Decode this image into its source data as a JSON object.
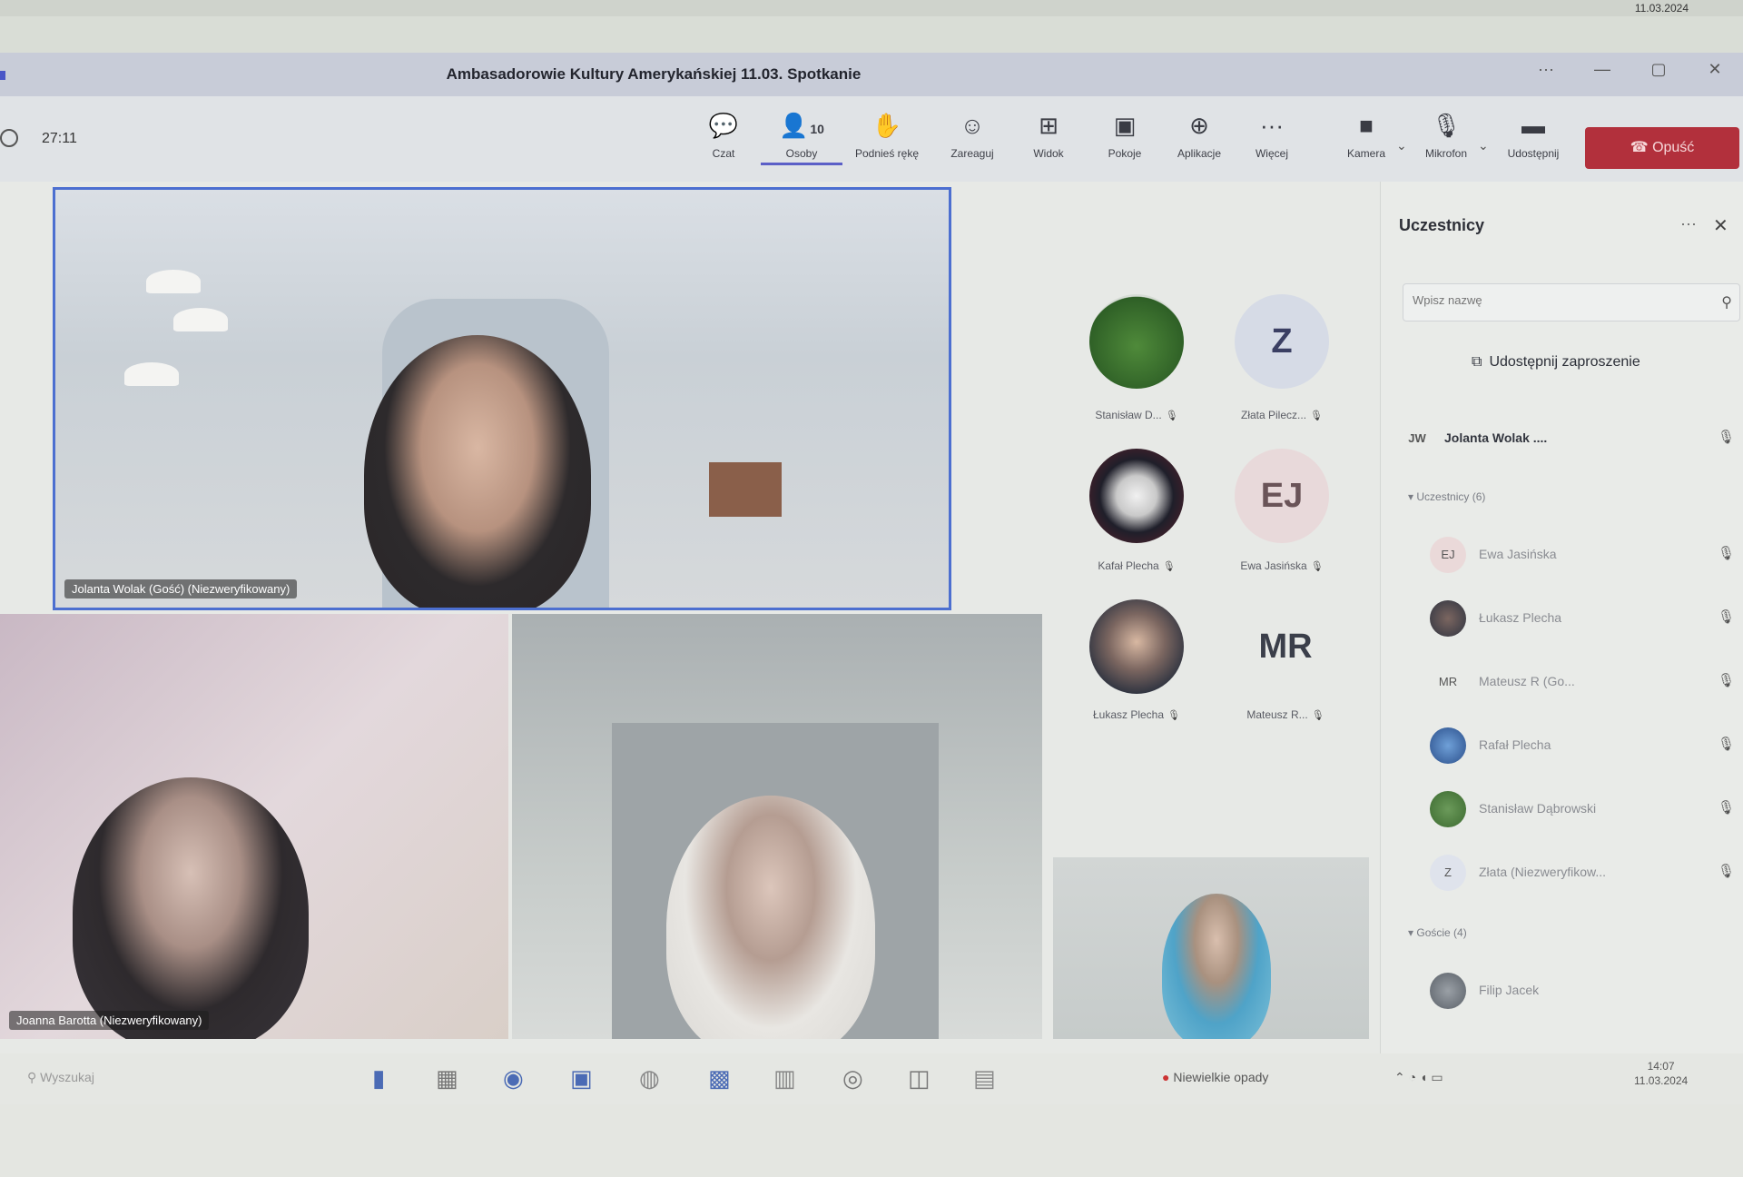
{
  "top_strip": {
    "date": "11.03.2024"
  },
  "window": {
    "title": "Ambasadorowie Kultury Amerykańskiej 11.03. Spotkanie",
    "controls": [
      "···",
      "—",
      "▢",
      "✕"
    ]
  },
  "toolbar": {
    "timer": "27:11",
    "buttons": [
      {
        "id": "chat",
        "label": "Czat",
        "icon": "chat-icon"
      },
      {
        "id": "people",
        "label": "Osoby",
        "icon": "people-icon",
        "count": "10",
        "active": true
      },
      {
        "id": "raise",
        "label": "Podnieś rękę",
        "icon": "hand-icon"
      },
      {
        "id": "react",
        "label": "Zareaguj",
        "icon": "smiley-icon"
      },
      {
        "id": "view",
        "label": "Widok",
        "icon": "grid-icon"
      },
      {
        "id": "rooms",
        "label": "Pokoje",
        "icon": "rooms-icon"
      },
      {
        "id": "apps",
        "label": "Aplikacje",
        "icon": "apps-icon"
      },
      {
        "id": "more",
        "label": "Więcej",
        "icon": "more-icon"
      },
      {
        "id": "camera",
        "label": "Kamera",
        "icon": "camera-icon"
      },
      {
        "id": "mic",
        "label": "Mikrofon",
        "icon": "mic-icon"
      },
      {
        "id": "share",
        "label": "Udostępnij",
        "icon": "share-icon"
      }
    ],
    "leave_label": "Opuść"
  },
  "stage": {
    "tiles": [
      {
        "name": "Jolanta Wolak (Gość) (Niezweryfikowany)"
      },
      {
        "name": "Joanna Barotta (Niezweryfikowany)"
      },
      {
        "name": ""
      },
      {
        "name": ""
      }
    ],
    "avatars": [
      {
        "label": "Stanisław D...",
        "kind": "frog"
      },
      {
        "label": "Złata Pilecz...",
        "kind": "initials",
        "initials": "Z"
      },
      {
        "label": "Kafał Plecha",
        "kind": "skull"
      },
      {
        "label": "Ewa Jasińska",
        "kind": "initials",
        "initials": "EJ"
      },
      {
        "label": "Łukasz Plecha",
        "kind": "photo"
      },
      {
        "label": "Mateusz R...",
        "kind": "initials",
        "initials": "MR"
      }
    ]
  },
  "panel": {
    "title": "Uczestnicy",
    "search_placeholder": "Wpisz nazwę",
    "invite_label": "Udostępnij zaproszenie",
    "organizer": {
      "initials": "JW",
      "name": "Jolanta Wolak ...."
    },
    "attendees_section": "Uczestnicy (6)",
    "attendees": [
      {
        "initials": "EJ",
        "name": "Ewa Jasińska"
      },
      {
        "initials": "",
        "name": "Łukasz Plecha"
      },
      {
        "initials": "MR",
        "name": "Mateusz R (Go..."
      },
      {
        "initials": "",
        "name": "Rafał Plecha"
      },
      {
        "initials": "",
        "name": "Stanisław Dąbrowski"
      },
      {
        "initials": "Z",
        "name": "Złata (Niezweryfikow..."
      }
    ],
    "guests_section": "Goście (4)",
    "guests": [
      {
        "initials": "",
        "name": "Filip Jacek"
      }
    ]
  },
  "taskbar": {
    "search_text": "Wyszukaj",
    "weather": "Niewielkie opady",
    "clock_time": "14:07",
    "clock_date": "11.03.2024"
  }
}
